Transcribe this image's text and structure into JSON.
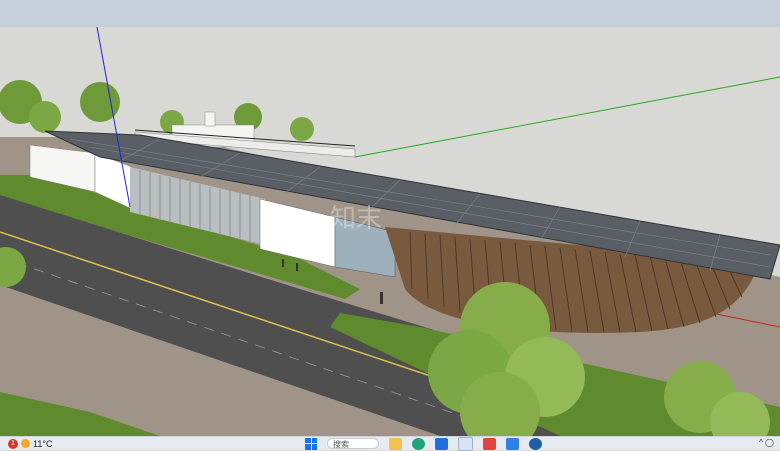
{
  "window": {
    "title": ""
  },
  "taskbar": {
    "weather": {
      "badge": "1",
      "temperature": "11°C"
    },
    "search_placeholder": "搜索",
    "apps": [
      {
        "icon": "file-explorer-icon",
        "color": "#f2c14e"
      },
      {
        "icon": "edge-browser-icon",
        "color": "#1fa37a"
      },
      {
        "icon": "store-icon",
        "color": "#1e6fd9"
      },
      {
        "icon": "mail-icon",
        "color": "#d9e4f2"
      },
      {
        "icon": "red-app-icon",
        "color": "#e0443e"
      },
      {
        "icon": "blue-app-icon",
        "color": "#2f80ed"
      },
      {
        "icon": "sketchup-icon",
        "color": "#1f5fa8"
      }
    ],
    "tray": "^ ◯"
  },
  "scene": {
    "sky_color": "#d8d8d4",
    "ground_color": "#a09488",
    "road_color": "#4f4f4f",
    "grass_color": "#5f8a2d",
    "roof_color": "#5a5f66",
    "wood_color": "#7a5a3f",
    "axis_colors": {
      "blue": "#2222dd",
      "green": "#22aa22",
      "red": "#cc2222"
    },
    "watermark": "知末"
  }
}
